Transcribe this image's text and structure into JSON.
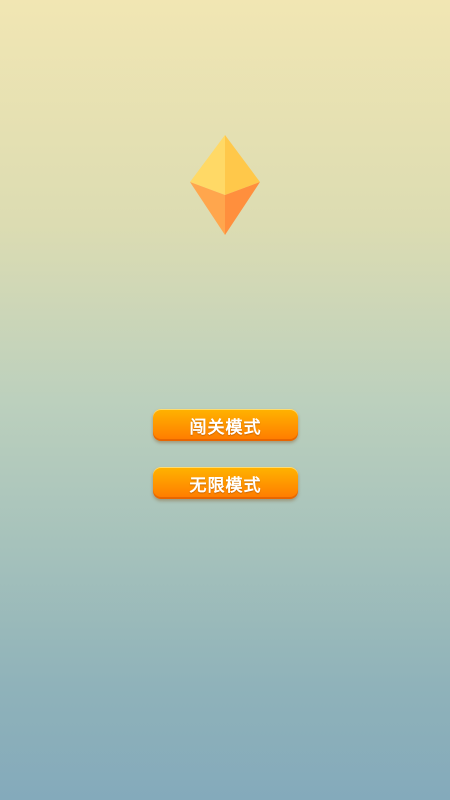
{
  "logo": {
    "icon": "diamond-gem-icon",
    "colors": {
      "top_left": "#ffd966",
      "top_right": "#ffc84a",
      "bottom_left": "#ffa64d",
      "bottom_right": "#ff8f3d"
    }
  },
  "menu": {
    "level_mode_label": "闯关模式",
    "endless_mode_label": "无限模式"
  },
  "colors": {
    "background_top": "#f1e6b3",
    "background_bottom": "#84aabb",
    "button_accent": "#ff9a00"
  }
}
